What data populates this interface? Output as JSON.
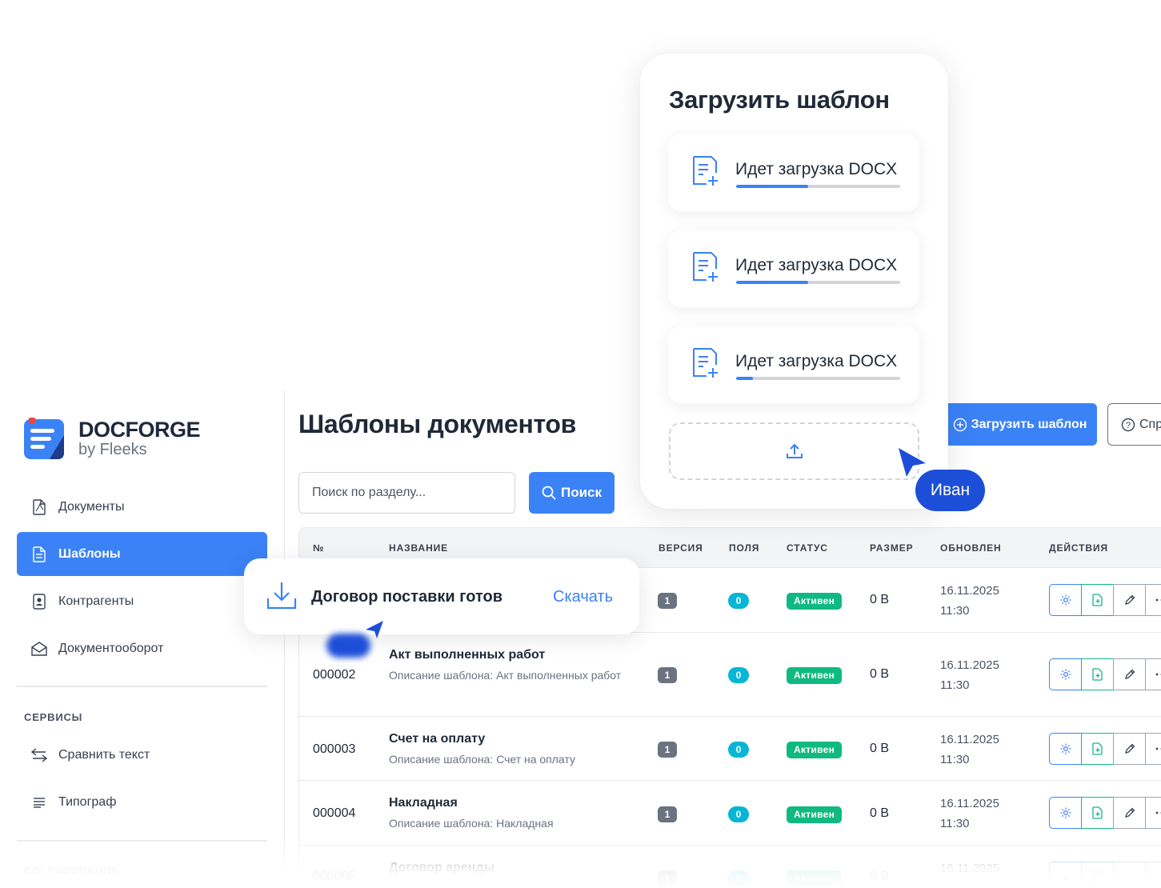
{
  "brand": {
    "name": "DOCFORGE",
    "subtitle": "by Fleeks"
  },
  "sidebar": {
    "items": [
      {
        "label": "Документы",
        "icon": "pdf-file-icon",
        "active": false
      },
      {
        "label": "Шаблоны",
        "icon": "document-icon",
        "active": true
      },
      {
        "label": "Контрагенты",
        "icon": "contact-card-icon",
        "active": false
      },
      {
        "label": "Документооборот",
        "icon": "envelope-icon",
        "active": false
      }
    ],
    "services_label": "СЕРВИСЫ",
    "services": [
      {
        "label": "Сравнить текст",
        "icon": "arrows-swap-icon"
      },
      {
        "label": "Типограф",
        "icon": "text-lines-icon"
      }
    ],
    "approval_label": "СОГЛАСОВАНИЕ"
  },
  "main": {
    "title": "Шаблоны документов",
    "search_placeholder": "Поиск по разделу...",
    "search_button": "Поиск",
    "upload_button": "Загрузить шаблон",
    "help_button": "Спр"
  },
  "table": {
    "headers": {
      "num": "№",
      "name": "НАЗВАНИЕ",
      "version": "ВЕРСИЯ",
      "fields": "ПОЛЯ",
      "status": "СТАТУС",
      "size": "РАЗМЕР",
      "updated": "ОБНОВЛЕН",
      "actions": "ДЕЙСТВИЯ"
    },
    "rows": [
      {
        "num": "",
        "name": "",
        "desc": "",
        "version": "1",
        "fields": "0",
        "status": "Активен",
        "size": "0 B",
        "date": "16.11.2025",
        "time": "11:30"
      },
      {
        "num": "000002",
        "name": "Акт выполненных работ",
        "desc": "Описание шаблона: Акт выполненных работ",
        "version": "1",
        "fields": "0",
        "status": "Активен",
        "size": "0 B",
        "date": "16.11.2025",
        "time": "11:30"
      },
      {
        "num": "000003",
        "name": "Счет на оплату",
        "desc": "Описание шаблона: Счет на оплату",
        "version": "1",
        "fields": "0",
        "status": "Активен",
        "size": "0 B",
        "date": "16.11.2025",
        "time": "11:30"
      },
      {
        "num": "000004",
        "name": "Накладная",
        "desc": "Описание шаблона: Накладная",
        "version": "1",
        "fields": "0",
        "status": "Активен",
        "size": "0 B",
        "date": "16.11.2025",
        "time": "11:30"
      },
      {
        "num": "000005",
        "name": "Договор аренды",
        "desc": "",
        "version": "1",
        "fields": "0",
        "status": "Активен",
        "size": "0 B",
        "date": "16.11.2025",
        "time": ""
      }
    ]
  },
  "upload_modal": {
    "title": "Загрузить шаблон",
    "items": [
      {
        "label": "Идет загрузка DOCX",
        "progress": 0.44
      },
      {
        "label": "Идет загрузка DOCX",
        "progress": 0.44
      },
      {
        "label": "Идет загрузка DOCX",
        "progress": 0.1
      }
    ]
  },
  "cursor_user": "Иван",
  "toast": {
    "message": "Договор поставки готов",
    "action": "Скачать"
  },
  "colors": {
    "primary": "#3b82f6",
    "success": "#10b981",
    "info": "#06b6d4",
    "cursor": "#1d4ed8"
  }
}
